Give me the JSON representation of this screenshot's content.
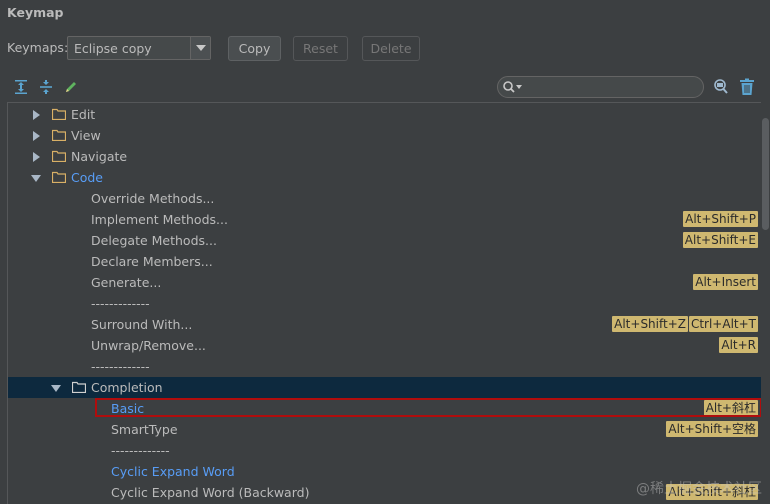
{
  "panel": {
    "title": "Keymap"
  },
  "toolbar": {
    "keymaps_label": "Keymaps:",
    "selected_keymap": "Eclipse copy",
    "copy_label": "Copy",
    "reset_label": "Reset",
    "delete_label": "Delete"
  },
  "icons": {
    "expand_all": "expand-all-icon",
    "collapse_all": "collapse-all-icon",
    "edit": "pencil-icon",
    "find_by_shortcut": "find-shortcut-icon",
    "clear": "trash-icon",
    "search": "search-icon"
  },
  "search": {
    "value": ""
  },
  "tree": {
    "edit": "Edit",
    "view": "View",
    "navigate": "Navigate",
    "code": "Code",
    "override_methods": "Override Methods...",
    "implement_methods": "Implement Methods...",
    "implement_methods_sc": "Alt+Shift+P",
    "delegate_methods": "Delegate Methods...",
    "delegate_methods_sc": "Alt+Shift+E",
    "declare_members": "Declare Members...",
    "generate": "Generate...",
    "generate_sc": "Alt+Insert",
    "sep1": "-------------",
    "surround_with": "Surround With...",
    "surround_with_sc1": "Alt+Shift+Z",
    "surround_with_sc2": "Ctrl+Alt+T",
    "unwrap_remove": "Unwrap/Remove...",
    "unwrap_remove_sc": "Alt+R",
    "sep2": "-------------",
    "completion": "Completion",
    "basic": "Basic",
    "basic_sc": "Alt+斜杠",
    "smarttype": "SmartType",
    "smarttype_sc": "Alt+Shift+空格",
    "sep3": "-------------",
    "cyclic_expand": "Cyclic Expand Word",
    "cyclic_expand_back": "Cyclic Expand Word (Backward)",
    "cyclic_expand_back_sc": "Alt+Shift+斜杠"
  },
  "watermark": "@稀土掘金技术社区",
  "colors": {
    "background": "#3c3f41",
    "selection": "#0d293e",
    "link": "#589df6",
    "shortcut_bg": "#cfb870",
    "highlight_border": "#b00d0d"
  }
}
